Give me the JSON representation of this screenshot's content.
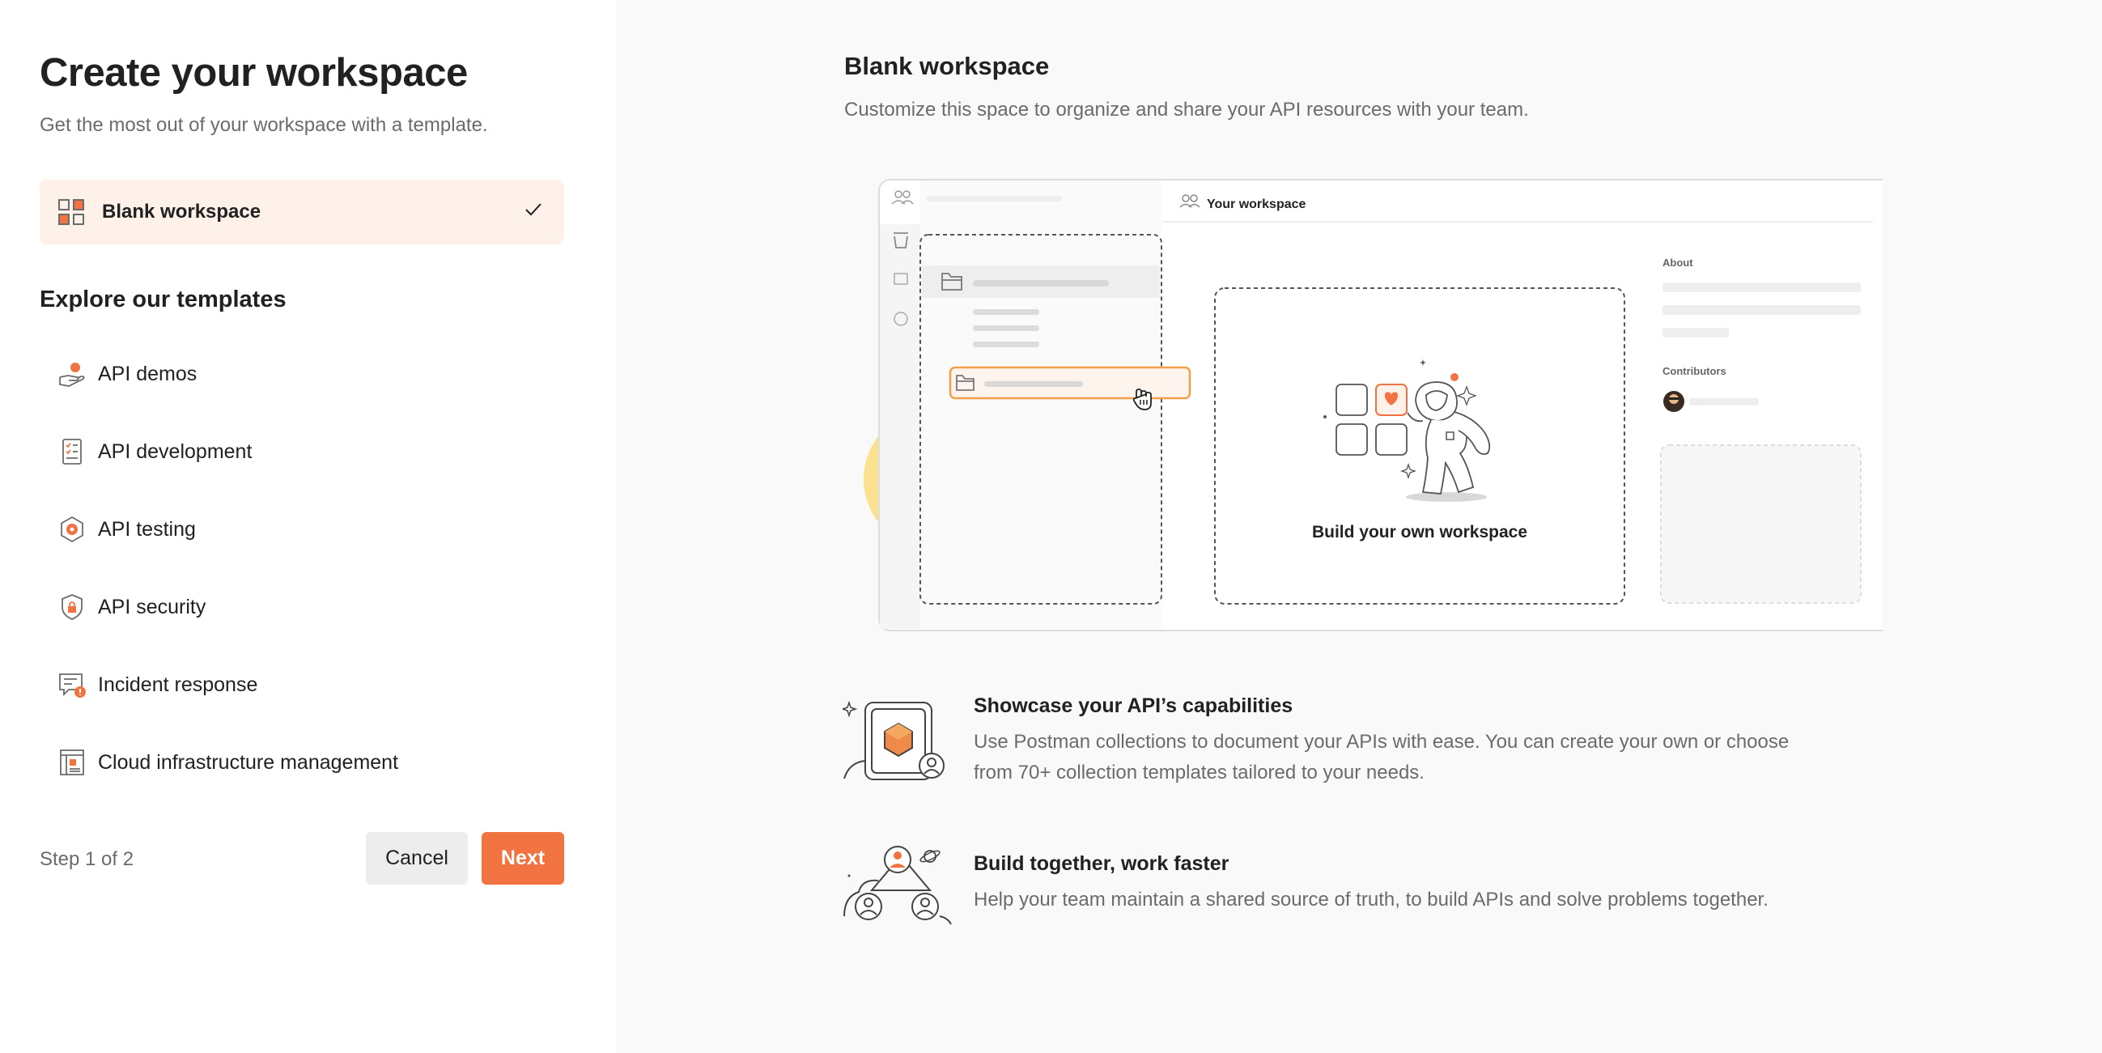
{
  "left": {
    "title": "Create your workspace",
    "subtitle": "Get the most out of your workspace with a template.",
    "blank_item": {
      "label": "Blank workspace",
      "icon": "grid-icon",
      "selected": true
    },
    "explore_heading": "Explore our templates",
    "templates": [
      {
        "label": "API demos",
        "icon": "hand-coin-icon"
      },
      {
        "label": "API development",
        "icon": "checklist-icon"
      },
      {
        "label": "API testing",
        "icon": "hexagon-gear-icon"
      },
      {
        "label": "API security",
        "icon": "shield-lock-icon"
      },
      {
        "label": "Incident response",
        "icon": "alert-message-icon"
      },
      {
        "label": "Cloud infrastructure management",
        "icon": "server-rack-icon"
      }
    ],
    "step_text": "Step 1 of 2",
    "cancel_label": "Cancel",
    "next_label": "Next"
  },
  "right": {
    "title": "Blank workspace",
    "subtitle": "Customize this space to organize and share your API resources with your team.",
    "illustration": {
      "workspace_label": "Your workspace",
      "center_caption": "Build your own workspace",
      "about_label": "About",
      "contributors_label": "Contributors"
    },
    "features": [
      {
        "title": "Showcase your API’s capabilities",
        "desc_line1": "Use Postman collections to document your APIs with ease. You can create your own or choose",
        "desc_line2": "from 70+ collection templates tailored to your needs.",
        "icon": "collection-showcase-icon"
      },
      {
        "title": "Build together, work faster",
        "desc_line1": "Help your team maintain a shared source of truth, to build APIs and solve problems together.",
        "icon": "team-network-icon"
      }
    ]
  },
  "colors": {
    "accent": "#f07341",
    "selected_bg": "#fdf1ea",
    "right_bg": "#f9f9f9",
    "yellow_blob": "#fbe18f"
  }
}
